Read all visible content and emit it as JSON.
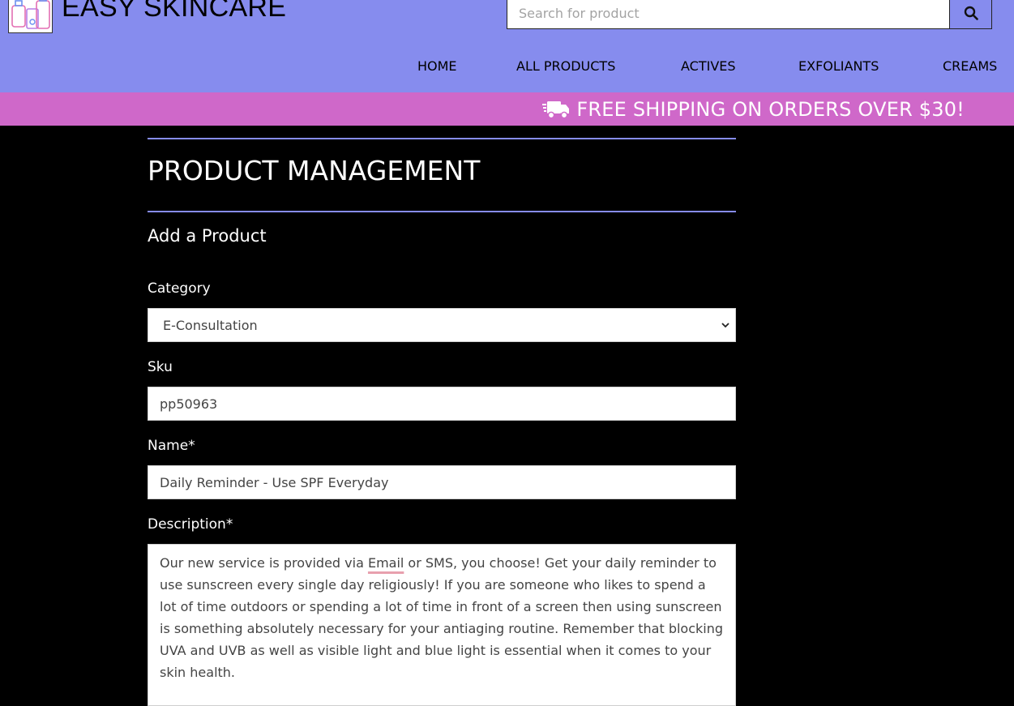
{
  "header": {
    "brand": "EASY SKINCARE",
    "logo_icon": "skincare-bottles-logo",
    "search": {
      "placeholder": "Search for product",
      "value": ""
    },
    "search_icon": "search-icon",
    "nav": [
      {
        "label": "HOME"
      },
      {
        "label": "ALL PRODUCTS"
      },
      {
        "label": "ACTIVES"
      },
      {
        "label": "EXFOLIANTS"
      },
      {
        "label": "CREAMS"
      }
    ]
  },
  "banner": {
    "icon": "shipping-truck-icon",
    "text": "FREE SHIPPING ON ORDERS OVER $30!"
  },
  "page": {
    "title": "PRODUCT MANAGEMENT",
    "section_title": "Add a Product"
  },
  "form": {
    "category": {
      "label": "Category",
      "value": "E-Consultation"
    },
    "sku": {
      "label": "Sku",
      "value": "pp50963"
    },
    "name": {
      "label": "Name*",
      "value": "Daily Reminder - Use SPF Everyday"
    },
    "description": {
      "label": "Description*",
      "pre": "Our new service is provided via ",
      "flagged_word": "Email",
      "post": " or SMS, you choose! Get your daily reminder to use sunscreen every single day religiously! If you are someone who likes to spend a lot of time outdoors or spending a lot of time in front of a screen then using sunscreen is something absolutely necessary for your antiaging routine. Remember that blocking UVA and UVB as well as visible light and blue light is essential when it comes to your skin health."
    }
  },
  "colors": {
    "header_bg": "#868cee",
    "banner_bg": "#cf68c9",
    "page_bg": "#000000",
    "rule": "#868cee"
  }
}
